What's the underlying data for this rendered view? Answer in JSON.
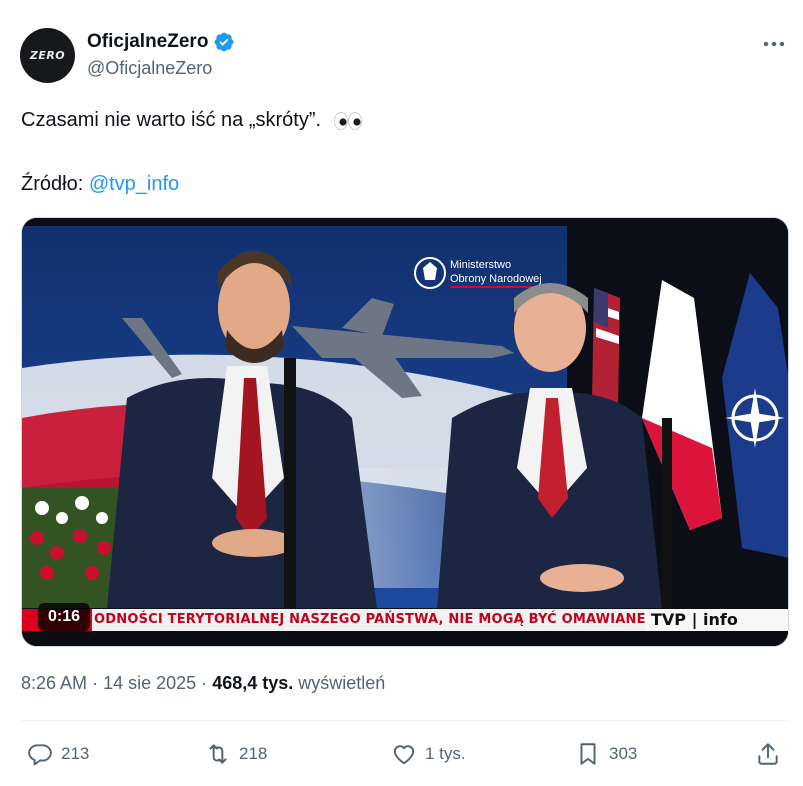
{
  "author": {
    "avatar_text": "ZERO",
    "display_name": "OficjalneZero",
    "handle": "@OficjalneZero"
  },
  "tweet": {
    "text_line1": "Czasami nie warto iść na „skróty”.",
    "source_label": "Źródło: ",
    "source_mention": "@tvp_info"
  },
  "media": {
    "video_time": "0:16",
    "ticker_text": "ODNOŚCI TERYTORIALNEJ NASZEGO PAŃSTWA, NIE MOGĄ BYĆ OMAWIANE BEZ NASZEGO PAŃS",
    "channel_logo": "TVP | info",
    "backdrop_line1": "Ministerstwo",
    "backdrop_line2": "Obrony Narodowej"
  },
  "meta": {
    "time": "8:26 AM",
    "date": "14 sie 2025",
    "separator": "·",
    "views_count": "468,4 tys.",
    "views_label": "wyświetleń"
  },
  "actions": {
    "replies": "213",
    "reposts": "218",
    "likes": "1 tys.",
    "bookmarks": "303"
  },
  "colors": {
    "accent": "#1d9bf0",
    "text_primary": "#0f1419",
    "text_secondary": "#536471",
    "verified_badge": "#1d9bf0"
  },
  "icons": [
    "verified-badge-icon",
    "more-icon",
    "eyes-emoji-icon",
    "reply-icon",
    "repost-icon",
    "like-icon",
    "bookmark-icon",
    "share-icon"
  ]
}
